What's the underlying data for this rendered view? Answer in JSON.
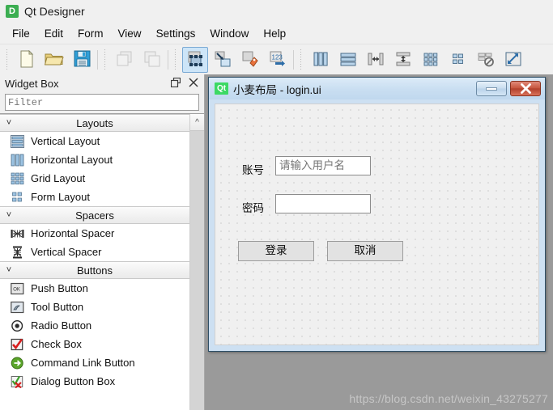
{
  "app": {
    "icon": "qt-designer-logo-icon",
    "icon_glyph": "D",
    "title": "Qt Designer"
  },
  "menubar": {
    "items": [
      {
        "label": "File"
      },
      {
        "label": "Edit"
      },
      {
        "label": "Form"
      },
      {
        "label": "View"
      },
      {
        "label": "Settings"
      },
      {
        "label": "Window"
      },
      {
        "label": "Help"
      }
    ]
  },
  "toolbar": {
    "groups": [
      {
        "buttons": [
          {
            "name": "new-form-button",
            "icon": "new-file-icon",
            "state": "enabled"
          },
          {
            "name": "open-form-button",
            "icon": "open-folder-icon",
            "state": "enabled"
          },
          {
            "name": "save-form-button",
            "icon": "save-floppy-icon",
            "state": "enabled"
          }
        ]
      },
      {
        "buttons": [
          {
            "name": "copy-button",
            "icon": "copy-icon",
            "state": "disabled"
          },
          {
            "name": "paste-button",
            "icon": "paste-icon",
            "state": "disabled"
          }
        ]
      },
      {
        "buttons": [
          {
            "name": "edit-widgets-button",
            "icon": "edit-widgets-icon",
            "state": "active"
          },
          {
            "name": "edit-signals-slots-button",
            "icon": "signals-slots-icon",
            "state": "enabled"
          },
          {
            "name": "edit-buddies-button",
            "icon": "buddies-icon",
            "state": "enabled"
          },
          {
            "name": "edit-tab-order-button",
            "icon": "tab-order-icon",
            "state": "enabled"
          }
        ]
      },
      {
        "buttons": [
          {
            "name": "layout-horizontally-button",
            "icon": "layout-horizontal-icon",
            "state": "enabled"
          },
          {
            "name": "layout-vertically-button",
            "icon": "layout-vertical-icon",
            "state": "enabled"
          },
          {
            "name": "layout-splitter-horizontal-button",
            "icon": "splitter-horizontal-icon",
            "state": "enabled"
          },
          {
            "name": "layout-splitter-vertical-button",
            "icon": "splitter-vertical-icon",
            "state": "enabled"
          },
          {
            "name": "layout-grid-button",
            "icon": "layout-grid-icon",
            "state": "enabled"
          },
          {
            "name": "layout-form-button",
            "icon": "layout-form-icon",
            "state": "enabled"
          },
          {
            "name": "break-layout-button",
            "icon": "break-layout-icon",
            "state": "enabled"
          },
          {
            "name": "adjust-size-button",
            "icon": "adjust-size-icon",
            "state": "enabled"
          }
        ]
      }
    ]
  },
  "widget_box": {
    "title": "Widget Box",
    "header_buttons": [
      {
        "name": "float-dock-button",
        "icon": "float-window-icon"
      },
      {
        "name": "close-dock-button",
        "icon": "close-icon"
      }
    ],
    "filter": {
      "value": "",
      "placeholder": "Filter"
    },
    "scroll_up_glyph": "^",
    "sections": [
      {
        "label": "Layouts",
        "chevron": "˅",
        "items": [
          {
            "label": "Vertical Layout",
            "icon": "vertical-layout-icon"
          },
          {
            "label": "Horizontal Layout",
            "icon": "horizontal-layout-icon"
          },
          {
            "label": "Grid Layout",
            "icon": "grid-layout-icon"
          },
          {
            "label": "Form Layout",
            "icon": "form-layout-icon"
          }
        ]
      },
      {
        "label": "Spacers",
        "chevron": "˅",
        "items": [
          {
            "label": "Horizontal Spacer",
            "icon": "horizontal-spacer-icon"
          },
          {
            "label": "Vertical Spacer",
            "icon": "vertical-spacer-icon"
          }
        ]
      },
      {
        "label": "Buttons",
        "chevron": "˅",
        "items": [
          {
            "label": "Push Button",
            "icon": "push-button-icon"
          },
          {
            "label": "Tool Button",
            "icon": "tool-button-icon"
          },
          {
            "label": "Radio Button",
            "icon": "radio-button-icon"
          },
          {
            "label": "Check Box",
            "icon": "check-box-icon"
          },
          {
            "label": "Command Link Button",
            "icon": "command-link-button-icon"
          },
          {
            "label": "Dialog Button Box",
            "icon": "dialog-button-box-icon"
          }
        ]
      }
    ]
  },
  "form_window": {
    "icon": "qt-logo-icon",
    "icon_glyph": "Qt",
    "title": "小麦布局 - login.ui",
    "window_buttons": [
      {
        "name": "minimize-button",
        "icon": "minimize-icon"
      },
      {
        "name": "close-button",
        "icon": "close-icon"
      }
    ],
    "form": {
      "account_label": "账号",
      "account_input": {
        "value": "",
        "placeholder": "请输入用户名"
      },
      "password_label": "密码",
      "password_input": {
        "value": "",
        "placeholder": ""
      },
      "login_button": "登录",
      "cancel_button": "取消"
    }
  },
  "watermark": {
    "text": "https://blog.csdn.net/weixin_43275277"
  },
  "colors": {
    "chrome": "#f0f0f0",
    "mdi_background": "#9a9a9a",
    "form_titlebar": "#c9def1",
    "accent_highlight": "#cde5f8",
    "close_button_red": "#c7573f",
    "qt_green": "#3cd964",
    "watermark_gray": "#c6c6c6"
  }
}
